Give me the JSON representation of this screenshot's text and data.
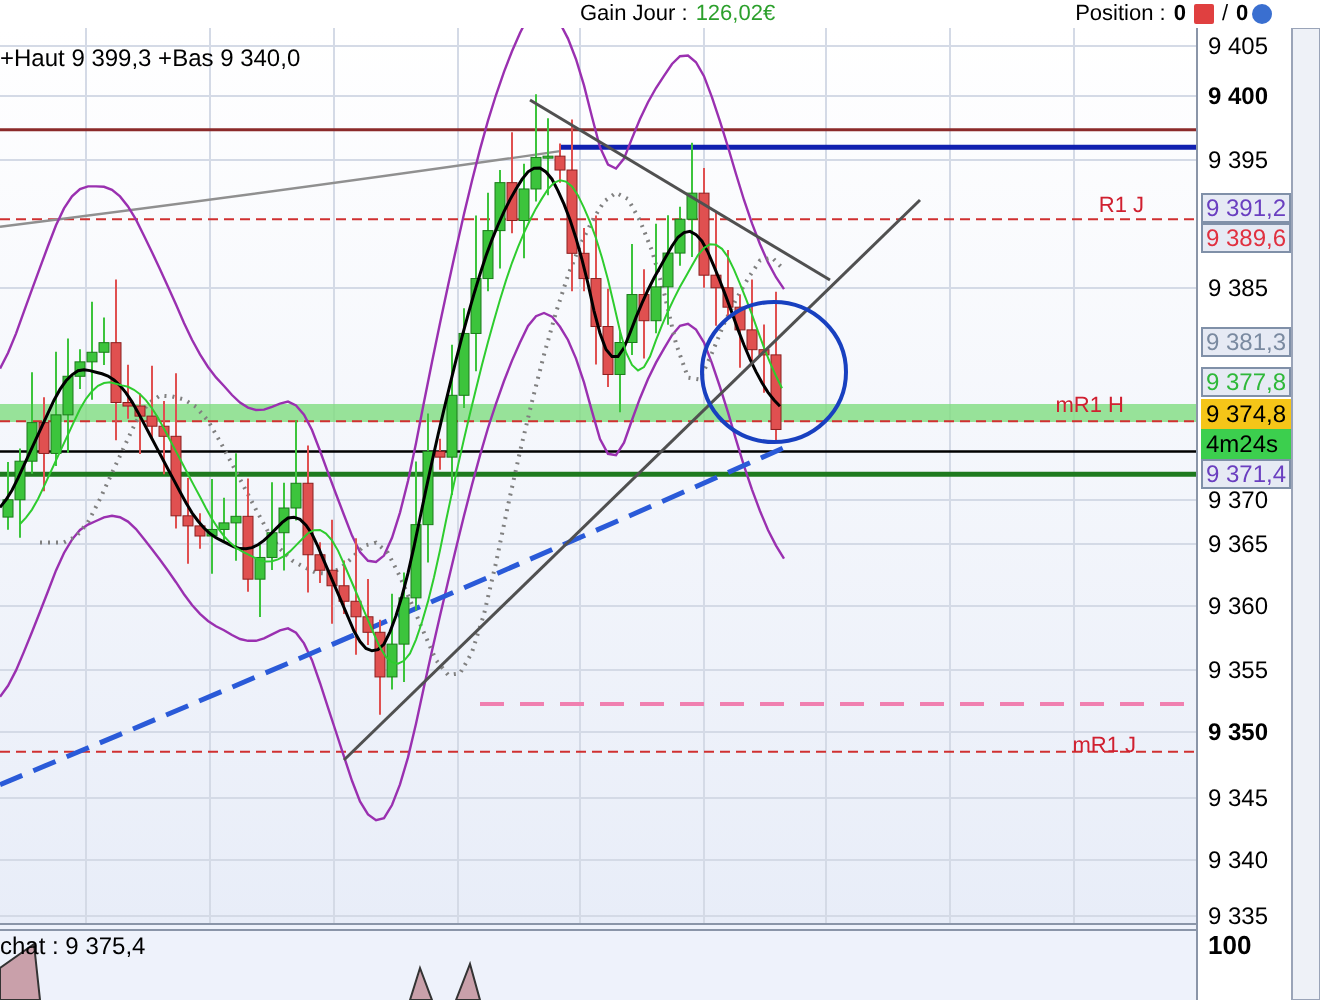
{
  "header": {
    "gain_label": "Gain Jour :",
    "gain_value": "126,02€",
    "position_label": "Position :",
    "position_long": "0",
    "separator": "/",
    "position_short": "0"
  },
  "price_chart": {
    "legend": "+Haut 9 399,3 +Bas 9 340,0",
    "ticks": [
      {
        "label": "9 405",
        "bold": false
      },
      {
        "label": "9 400",
        "bold": true
      },
      {
        "label": "9 395",
        "bold": false
      },
      {
        "label": "9 385",
        "bold": false
      },
      {
        "label": "9 370",
        "bold": false
      },
      {
        "label": "9 365",
        "bold": false
      },
      {
        "label": "9 360",
        "bold": false
      },
      {
        "label": "9 355",
        "bold": false
      },
      {
        "label": "9 350",
        "bold": true
      },
      {
        "label": "9 345",
        "bold": false
      },
      {
        "label": "9 340",
        "bold": false
      },
      {
        "label": "9 335",
        "bold": false
      }
    ],
    "level_labels": [
      {
        "text": "R1 J"
      },
      {
        "text": "mR1 H"
      },
      {
        "text": "mR1 J"
      }
    ],
    "price_tags": [
      {
        "text": "9 391,2",
        "kind": "outline",
        "color": "#6a3fc0"
      },
      {
        "text": "9 389,6",
        "kind": "outline",
        "color": "#e03040"
      },
      {
        "text": "9 381,3",
        "kind": "outline",
        "color": "#7a8aa0"
      },
      {
        "text": "9 377,8",
        "kind": "outline",
        "color": "#2fb83a"
      },
      {
        "text": "9 374,8",
        "kind": "filled",
        "color": "#f5c518"
      },
      {
        "text": "4m24s",
        "kind": "filled",
        "color": "#3ccf4e"
      },
      {
        "text": "9 371,4",
        "kind": "outline",
        "color": "#6a3fc0"
      }
    ]
  },
  "indicator_panel": {
    "legend": "chat : 9 375,4",
    "ticks": [
      {
        "label": "100",
        "bold": true
      }
    ]
  }
}
